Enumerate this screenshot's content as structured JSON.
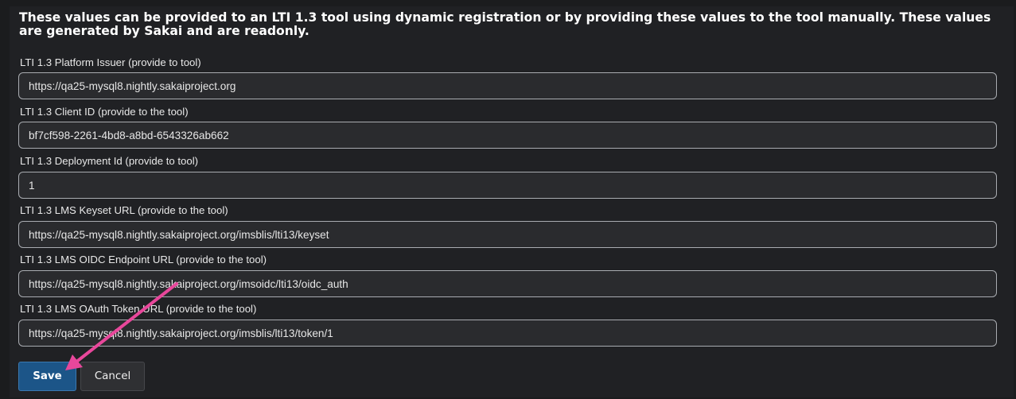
{
  "intro_text": "These values can be provided to an LTI 1.3 tool using dynamic registration or by providing these values to the tool manually. These values are generated by Sakai and are readonly.",
  "fields": [
    {
      "label": "LTI 1.3 Platform Issuer (provide to tool)",
      "value": "https://qa25-mysql8.nightly.sakaiproject.org"
    },
    {
      "label": "LTI 1.3 Client ID (provide to the tool)",
      "value": "bf7cf598-2261-4bd8-a8bd-6543326ab662"
    },
    {
      "label": "LTI 1.3 Deployment Id (provide to tool)",
      "value": "1"
    },
    {
      "label": "LTI 1.3 LMS Keyset URL (provide to the tool)",
      "value": "https://qa25-mysql8.nightly.sakaiproject.org/imsblis/lti13/keyset"
    },
    {
      "label": "LTI 1.3 LMS OIDC Endpoint URL (provide to the tool)",
      "value": "https://qa25-mysql8.nightly.sakaiproject.org/imsoidc/lti13/oidc_auth"
    },
    {
      "label": "LTI 1.3 LMS OAuth Token URL (provide to the tool)",
      "value": "https://qa25-mysql8.nightly.sakaiproject.org/imsblis/lti13/token/1"
    }
  ],
  "buttons": {
    "save_label": "Save",
    "cancel_label": "Cancel"
  },
  "colors": {
    "background": "#202124",
    "input_border": "#a9acb1",
    "save_button": "#1c5588",
    "annotation_arrow": "#e8479b"
  }
}
